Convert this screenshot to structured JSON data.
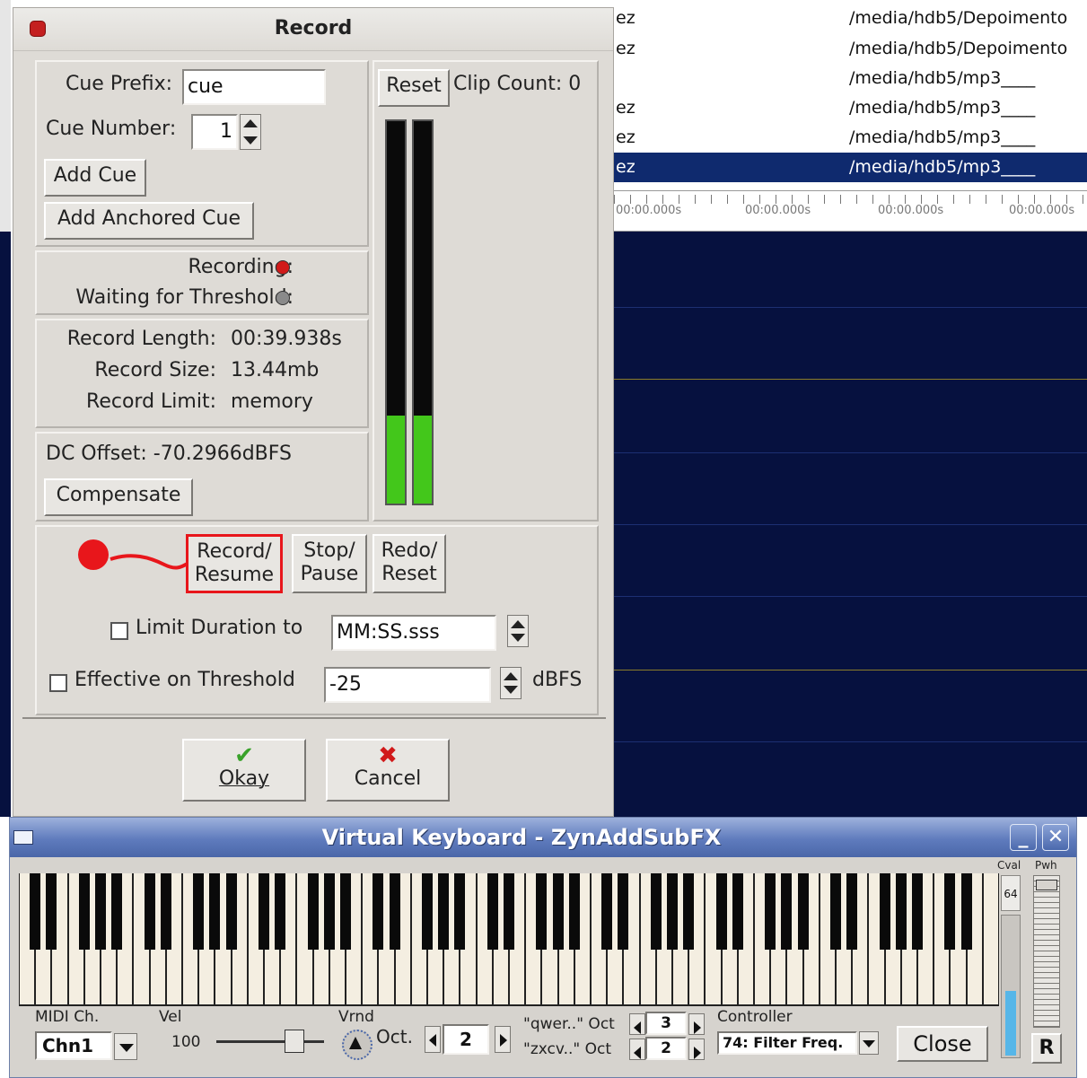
{
  "background_app": {
    "rows": [
      {
        "c1": "ez",
        "c2": "/media/hdb5/Depoimento"
      },
      {
        "c1": "ez",
        "c2": "/media/hdb5/Depoimento"
      },
      {
        "c1": "",
        "c2": "/media/hdb5/mp3____"
      },
      {
        "c1": "ez",
        "c2": "/media/hdb5/mp3____"
      },
      {
        "c1": "ez",
        "c2": "/media/hdb5/mp3____"
      },
      {
        "c1": "ez",
        "c2": "/media/hdb5/mp3____"
      }
    ],
    "ruler_labels": [
      "00:00.000s",
      "00:00.000s",
      "00:00.000s",
      "00:00.000s"
    ]
  },
  "record_dialog": {
    "title": "Record",
    "cue_prefix_label": "Cue Prefix:",
    "cue_prefix_value": "cue",
    "cue_number_label": "Cue Number:",
    "cue_number_value": "1",
    "add_cue": "Add Cue",
    "add_anchored_cue": "Add Anchored Cue",
    "reset": "Reset",
    "clip_count": "Clip Count: 0",
    "recording_label": "Recording:",
    "waiting_label": "Waiting for Threshold:",
    "record_length_label": "Record Length:",
    "record_length_value": "00:39.938s",
    "record_size_label": "Record Size:",
    "record_size_value": "13.44mb",
    "record_limit_label": "Record Limit:",
    "record_limit_value": "memory",
    "dc_offset": "DC Offset: -70.2966dBFS",
    "compensate": "Compensate",
    "record_resume_1": "Record/",
    "record_resume_2": "Resume",
    "stop_pause_1": "Stop/",
    "stop_pause_2": "Pause",
    "redo_reset_1": "Redo/",
    "redo_reset_2": "Reset",
    "limit_duration_label": "Limit Duration to",
    "limit_duration_value": "MM:SS.sss",
    "threshold_label": "Effective on Threshold",
    "threshold_value": "-25",
    "threshold_unit": "dBFS",
    "okay": "Okay",
    "cancel": "Cancel",
    "meter_levels": [
      0.23,
      0.23
    ],
    "colors": {
      "recording_led": "#d11a1a",
      "waiting_led": "#8a8a8a",
      "meter_fill": "#43c71b",
      "annotation": "#e8161b"
    }
  },
  "virtual_keyboard": {
    "title": "Virtual Keyboard - ZynAddSubFX",
    "cval_label": "Cval",
    "pwh_label": "Pwh",
    "cval_value": "64",
    "midi_ch_label": "MIDI Ch.",
    "midi_ch_value": "Chn1",
    "vel_label": "Vel",
    "vel_value": "100",
    "vrnd_label": "Vrnd",
    "oct_label": "Oct.",
    "oct_value": "2",
    "qwer_label": "\"qwer..\" Oct",
    "qwer_value": "3",
    "zxcv_label": "\"zxcv..\" Oct",
    "zxcv_value": "2",
    "controller_label": "Controller",
    "controller_value": "74: Filter Freq.",
    "close": "Close",
    "r_button": "R",
    "white_key_count": 60
  }
}
